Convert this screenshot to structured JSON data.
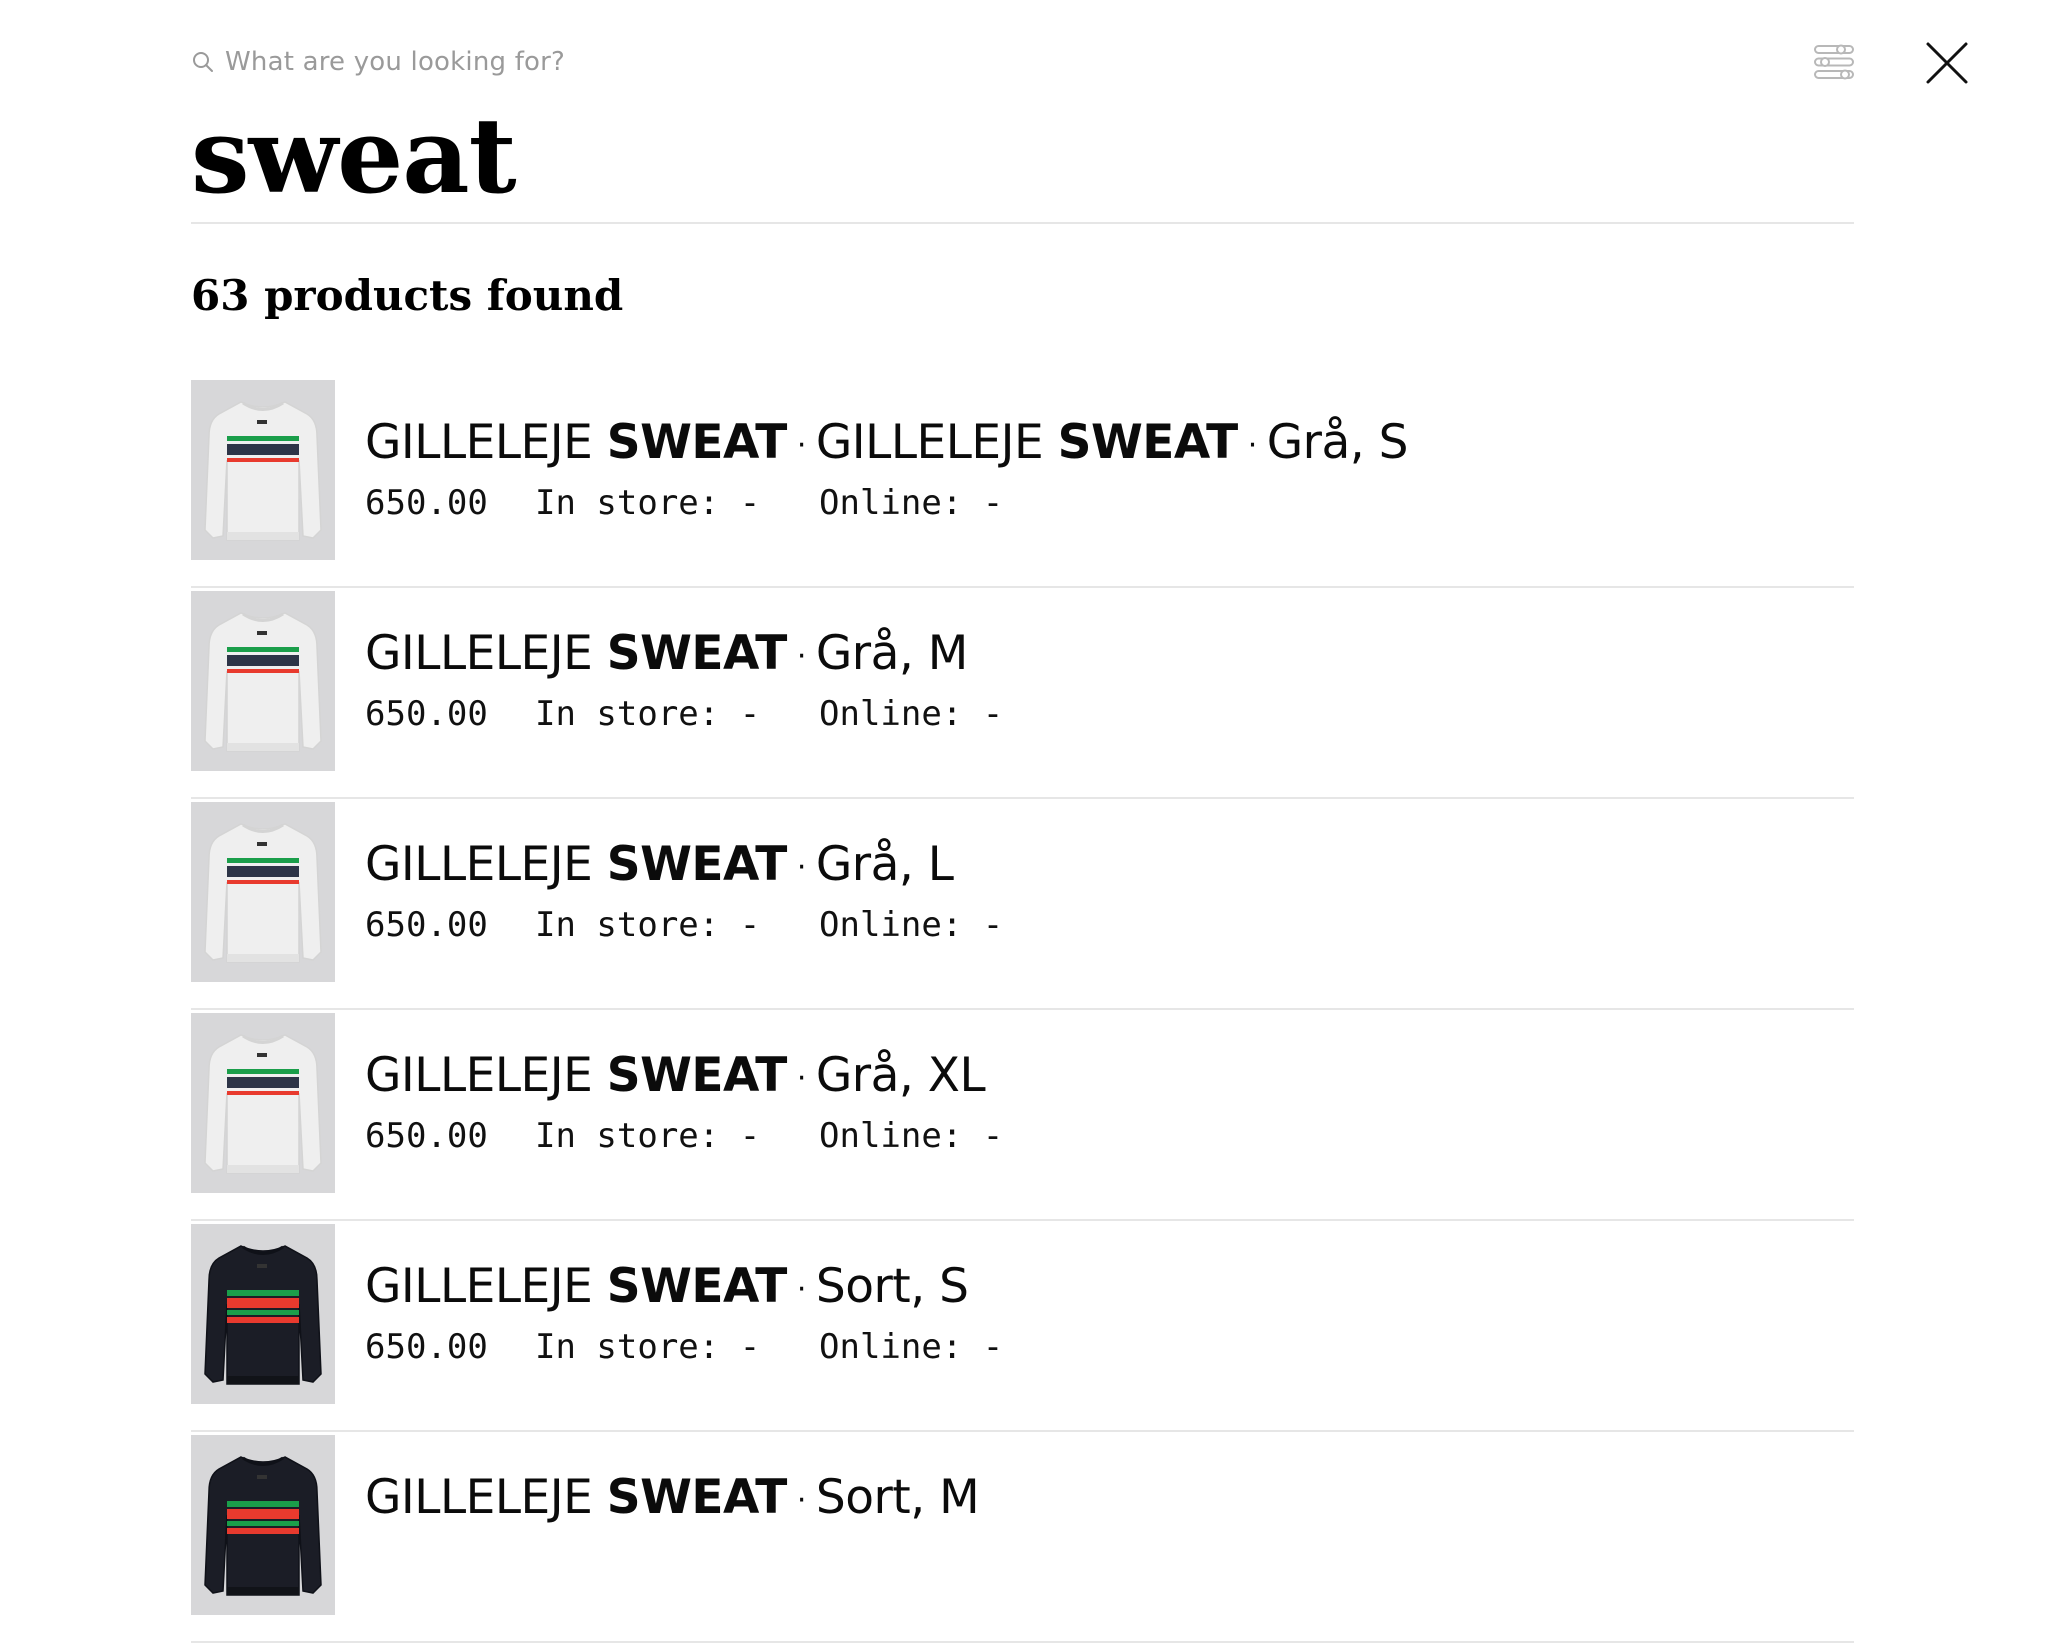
{
  "search": {
    "placeholder": "What are you looking for?",
    "query": "sweat"
  },
  "results": {
    "count_label": "63 products found"
  },
  "icons": {
    "search": "search-icon",
    "filter": "filter-sliders-icon",
    "close": "close-icon"
  },
  "products": [
    {
      "title_parts": [
        {
          "text": "GILLELEJE ",
          "style": "light"
        },
        {
          "text": "SWEAT",
          "style": "bold"
        },
        {
          "text": "·",
          "style": "sep"
        },
        {
          "text": "GILLELEJE ",
          "style": "light"
        },
        {
          "text": "SWEAT",
          "style": "bold"
        },
        {
          "text": "·",
          "style": "sep"
        },
        {
          "text": "Grå, S",
          "style": "light"
        }
      ],
      "price": "650.00",
      "in_store": "In store: -",
      "online": "Online: -",
      "thumbnail": "grey-sweater"
    },
    {
      "title_parts": [
        {
          "text": "GILLELEJE ",
          "style": "light"
        },
        {
          "text": "SWEAT",
          "style": "bold"
        },
        {
          "text": "·",
          "style": "sep"
        },
        {
          "text": "Grå, M",
          "style": "light"
        }
      ],
      "price": "650.00",
      "in_store": "In store: -",
      "online": "Online: -",
      "thumbnail": "grey-sweater"
    },
    {
      "title_parts": [
        {
          "text": "GILLELEJE ",
          "style": "light"
        },
        {
          "text": "SWEAT",
          "style": "bold"
        },
        {
          "text": "·",
          "style": "sep"
        },
        {
          "text": "Grå, L",
          "style": "light"
        }
      ],
      "price": "650.00",
      "in_store": "In store: -",
      "online": "Online: -",
      "thumbnail": "grey-sweater"
    },
    {
      "title_parts": [
        {
          "text": "GILLELEJE ",
          "style": "light"
        },
        {
          "text": "SWEAT",
          "style": "bold"
        },
        {
          "text": "·",
          "style": "sep"
        },
        {
          "text": "Grå, XL",
          "style": "light"
        }
      ],
      "price": "650.00",
      "in_store": "In store: -",
      "online": "Online: -",
      "thumbnail": "grey-sweater"
    },
    {
      "title_parts": [
        {
          "text": "GILLELEJE ",
          "style": "light"
        },
        {
          "text": "SWEAT",
          "style": "bold"
        },
        {
          "text": "·",
          "style": "sep"
        },
        {
          "text": "Sort, S",
          "style": "light"
        }
      ],
      "price": "650.00",
      "in_store": "In store: -",
      "online": "Online: -",
      "thumbnail": "black-sweater"
    },
    {
      "title_parts": [
        {
          "text": "GILLELEJE ",
          "style": "light"
        },
        {
          "text": "SWEAT",
          "style": "bold"
        },
        {
          "text": "·",
          "style": "sep"
        },
        {
          "text": "Sort, M",
          "style": "light"
        }
      ],
      "price": "",
      "in_store": "",
      "online": "",
      "thumbnail": "black-sweater"
    }
  ],
  "colors": {
    "stripe_green": "#1a9e4a",
    "stripe_navy": "#2d3447",
    "stripe_red": "#e83a2e",
    "sweater_grey": "#efefef",
    "sweater_black": "#1b1d26",
    "thumb_background": "#d7d7d9",
    "divider": "#e6e6e6"
  }
}
